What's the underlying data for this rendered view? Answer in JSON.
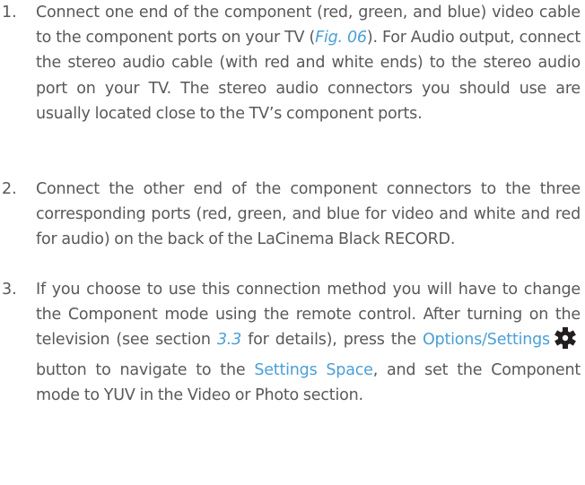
{
  "steps": [
    {
      "number": "1.",
      "parts": [
        "Connect one end of the component (red, green, and blue) video cable to the component ports on your TV (",
        "Fig. 06",
        "). For Audio output, connect the stereo audio cable (with red and white ends) to the stereo audio port on your TV. The stereo audio connectors you should use are usually located close to the TV’s component ports."
      ]
    },
    {
      "number": "2.",
      "parts": [
        "Connect the other end of the component connectors to the three corresponding ports (red, green, and blue for video and white and red for audio) on the back of the LaCinema Black RECORD."
      ]
    },
    {
      "number": "3.",
      "parts": [
        "If you choose to use this connection method you will have to change the Component mode using the remote control. After turning on the television (see section ",
        "3.3",
        " for details), press the ",
        "Options/Settings",
        " button to navigate to the ",
        "Settings Space",
        ", and set the Component mode to YUV in the Video or Photo section."
      ]
    }
  ],
  "icons": {
    "settings": "gear-icon"
  },
  "colors": {
    "text": "#58595b",
    "link": "#4a9fd6",
    "icon": "#231f20"
  }
}
